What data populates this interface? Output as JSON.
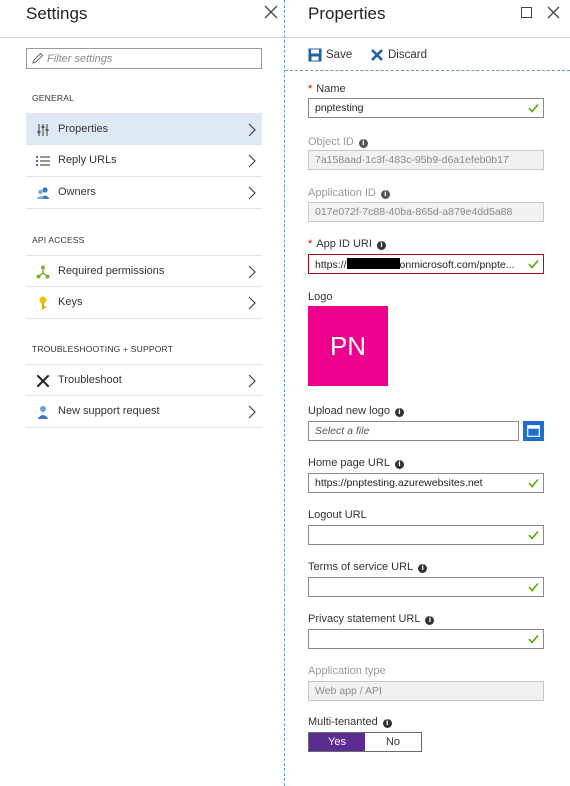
{
  "settings": {
    "title": "Settings",
    "filter_placeholder": "Filter settings",
    "sections": [
      {
        "label": "GENERAL"
      },
      {
        "label": "API ACCESS"
      },
      {
        "label": "TROUBLESHOOTING + SUPPORT"
      }
    ],
    "items": [
      {
        "label": "Properties",
        "icon": "properties-sliders-icon",
        "active": true
      },
      {
        "label": "Reply URLs",
        "icon": "list-icon"
      },
      {
        "label": "Owners",
        "icon": "people-icon"
      },
      {
        "label": "Required permissions",
        "icon": "permissions-tree-icon"
      },
      {
        "label": "Keys",
        "icon": "key-icon"
      },
      {
        "label": "Troubleshoot",
        "icon": "wrench-tools-icon"
      },
      {
        "label": "New support request",
        "icon": "support-person-icon"
      }
    ]
  },
  "properties": {
    "title": "Properties",
    "toolbar": {
      "save_label": "Save",
      "discard_label": "Discard"
    },
    "fields": {
      "name": {
        "label": "Name",
        "value": "pnptesting",
        "required": true
      },
      "object_id": {
        "label": "Object ID",
        "value": "7a158aad-1c3f-483c-95b9-d6a1efeb0b17"
      },
      "application_id": {
        "label": "Application ID",
        "value": "017e072f-7c88-40ba-865d-a879e4dd5a88"
      },
      "app_id_uri": {
        "label": "App ID URI",
        "value_prefix": "https://",
        "value_suffix": "onmicrosoft.com/pnpte...",
        "required": true
      },
      "logo": {
        "label": "Logo",
        "initials": "PN"
      },
      "upload_logo": {
        "label": "Upload new logo",
        "placeholder": "Select a file"
      },
      "home_page_url": {
        "label": "Home page URL",
        "value": "https://pnptesting.azurewebsites.net"
      },
      "logout_url": {
        "label": "Logout URL",
        "value": ""
      },
      "terms_url": {
        "label": "Terms of service URL",
        "value": ""
      },
      "privacy_url": {
        "label": "Privacy statement URL",
        "value": ""
      },
      "application_type": {
        "label": "Application type",
        "value": "Web app / API"
      },
      "multi_tenanted": {
        "label": "Multi-tenanted",
        "options": [
          "Yes",
          "No"
        ],
        "selected": "Yes"
      }
    }
  },
  "colors": {
    "accent_blue": "#1f6fd1",
    "active_item_bg": "#dfe9f6",
    "logo_magenta": "#ec008c",
    "toggle_purple": "#5c2d91",
    "valid_check_green": "#5aa800",
    "required_red": "#c00000"
  }
}
